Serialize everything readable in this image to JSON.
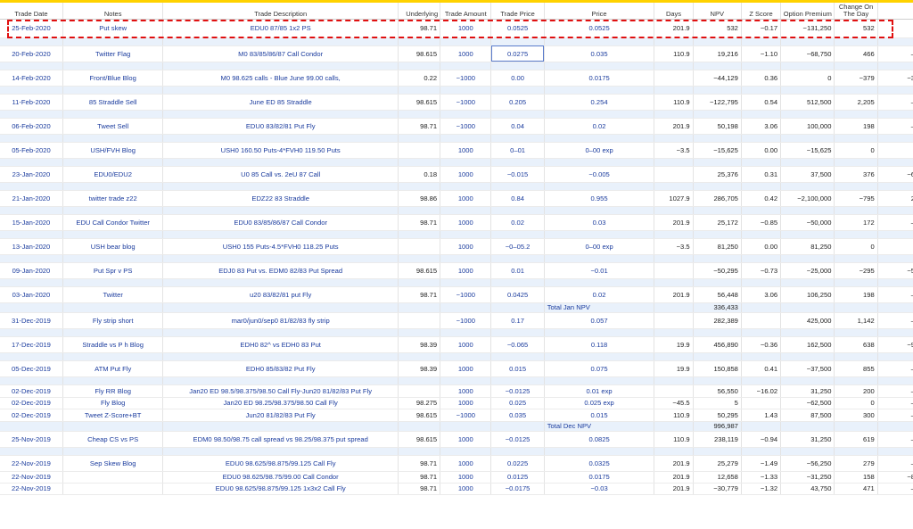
{
  "headers": [
    "Trade Date",
    "Notes",
    "Trade Description",
    "Underlying",
    "Trade Amount",
    "Trade Price",
    "Price",
    "Days",
    "NPV",
    "Z Score",
    "Option Premium",
    "Change On The Day",
    ""
  ],
  "rows": [
    {
      "kind": "main",
      "h": 21,
      "cells": [
        "25-Feb-2020",
        "Put skew",
        "EDU0 87/85 1x2 PS",
        "98.71",
        "1000",
        "0.0525",
        "0.0525",
        "201.9",
        "532",
        "−0.17",
        "−131,250",
        "532",
        ""
      ]
    },
    {
      "kind": "sub",
      "cells": []
    },
    {
      "kind": "main",
      "h": 18,
      "cells": [
        "20-Feb-2020",
        "Twitter Flag",
        "M0 83/85/86/87 Call Condor",
        "98.615",
        "1000",
        "0.0275",
        "0.035",
        "110.9",
        "19,216",
        "−1.10",
        "−68,750",
        "466",
        "–"
      ]
    },
    {
      "kind": "sub",
      "cells": []
    },
    {
      "kind": "main",
      "h": 18,
      "cells": [
        "14-Feb-2020",
        "Front/Blue Blog",
        "M0 98.625 calls - Blue June 99.00 calls,",
        "0.22",
        "−1000",
        "0.00",
        "0.0175",
        "",
        "−44,129",
        "0.36",
        "0",
        "−379",
        "−3"
      ]
    },
    {
      "kind": "sub",
      "cells": []
    },
    {
      "kind": "main",
      "h": 18,
      "cells": [
        "11-Feb-2020",
        "85 Straddle Sell",
        "June ED 85 Straddle",
        "98.615",
        "−1000",
        "0.205",
        "0.254",
        "110.9",
        "−122,795",
        "0.54",
        "512,500",
        "2,205",
        "–"
      ]
    },
    {
      "kind": "sub",
      "cells": []
    },
    {
      "kind": "main",
      "h": 18,
      "cells": [
        "06-Feb-2020",
        "Tweet Sell",
        "EDU0 83/82/81 Put Fly",
        "98.71",
        "−1000",
        "0.04",
        "0.02",
        "201.9",
        "50,198",
        "3.06",
        "100,000",
        "198",
        "–"
      ]
    },
    {
      "kind": "sub",
      "cells": []
    },
    {
      "kind": "main",
      "h": 18,
      "cells": [
        "05-Feb-2020",
        "USH/FVH Blog",
        "USH0 160.50 Puts-4*FVH0 119.50 Puts",
        "",
        "1000",
        "0–01",
        "0–00 exp",
        "−3.5",
        "−15,625",
        "0.00",
        "−15,625",
        "0",
        ""
      ]
    },
    {
      "kind": "sub",
      "cells": []
    },
    {
      "kind": "main",
      "h": 18,
      "cells": [
        "23-Jan-2020",
        "EDU0/EDU2",
        "U0 85 Call vs. 2eU 87 Call",
        "0.18",
        "1000",
        "−0.015",
        "−0.005",
        "",
        "25,376",
        "0.31",
        "37,500",
        "376",
        "−6"
      ]
    },
    {
      "kind": "sub",
      "cells": []
    },
    {
      "kind": "main",
      "h": 18,
      "cells": [
        "21-Jan-2020",
        "twitter trade z22",
        "EDZ22 83 Straddle",
        "98.86",
        "1000",
        "0.84",
        "0.955",
        "1027.9",
        "286,705",
        "0.42",
        "−2,100,000",
        "−795",
        "2"
      ]
    },
    {
      "kind": "sub",
      "cells": []
    },
    {
      "kind": "main",
      "h": 18,
      "cells": [
        "15-Jan-2020",
        "EDU Call Condor Twitter",
        "EDU0 83/85/86/87 Call Condor",
        "98.71",
        "1000",
        "0.02",
        "0.03",
        "201.9",
        "25,172",
        "−0.85",
        "−50,000",
        "172",
        "–"
      ]
    },
    {
      "kind": "sub",
      "cells": []
    },
    {
      "kind": "main",
      "h": 18,
      "cells": [
        "13-Jan-2020",
        "USH bear blog",
        "USH0 155 Puts-4.5*FVH0 118.25 Puts",
        "",
        "1000",
        "−0–05.2",
        "0–00 exp",
        "−3.5",
        "81,250",
        "0.00",
        "81,250",
        "0",
        ""
      ]
    },
    {
      "kind": "sub",
      "cells": []
    },
    {
      "kind": "main",
      "h": 18,
      "cells": [
        "09-Jan-2020",
        "Put Spr v PS",
        "EDJ0 83 Put vs. EDM0 82/83 Put Spread",
        "98.615",
        "1000",
        "0.01",
        "−0.01",
        "",
        "−50,295",
        "−0.73",
        "−25,000",
        "−295",
        "−5"
      ]
    },
    {
      "kind": "sub",
      "cells": []
    },
    {
      "kind": "main",
      "h": 18,
      "cells": [
        "03-Jan-2020",
        "Twitter",
        "u20 83/82/81 put Fly",
        "98.71",
        "−1000",
        "0.0425",
        "0.02",
        "201.9",
        "56,448",
        "3.06",
        "106,250",
        "198",
        "–"
      ]
    },
    {
      "kind": "total",
      "h": 11,
      "cells": [
        "",
        "",
        "",
        "",
        "",
        "",
        "Total Jan NPV",
        "",
        "336,433",
        "",
        "",
        "",
        ""
      ]
    },
    {
      "kind": "main",
      "h": 18,
      "cells": [
        "31-Dec-2019",
        "Fly strip short",
        "mar0/jun0/sep0 81/82/83 fly strip",
        "",
        "−1000",
        "0.17",
        "0.057",
        "",
        "282,389",
        "",
        "425,000",
        "1,142",
        "–"
      ]
    },
    {
      "kind": "sub",
      "cells": []
    },
    {
      "kind": "main",
      "h": 18,
      "cells": [
        "17-Dec-2019",
        "Straddle vs P h Blog",
        "EDH0 82^ vs EDH0 83 Put",
        "98.39",
        "1000",
        "−0.065",
        "0.118",
        "19.9",
        "456,890",
        "−0.36",
        "162,500",
        "638",
        "−9"
      ]
    },
    {
      "kind": "sub",
      "cells": []
    },
    {
      "kind": "main",
      "h": 18,
      "cells": [
        "05-Dec-2019",
        "ATM Put Fly",
        "EDH0 85/83/82 Put Fly",
        "98.39",
        "1000",
        "0.015",
        "0.075",
        "19.9",
        "150,858",
        "0.41",
        "−37,500",
        "855",
        "–"
      ]
    },
    {
      "kind": "sub",
      "cells": []
    },
    {
      "kind": "main",
      "h": 14,
      "cells": [
        "02-Dec-2019",
        "Fly RR Blog",
        "Jan20 ED 98.5/98.375/98.50 Call Fly-Jun20 81/82/83 Put Fly",
        "",
        "1000",
        "−0.0125",
        "0.01 exp",
        "",
        "56,550",
        "−16.02",
        "31,250",
        "200",
        "–"
      ]
    },
    {
      "kind": "main",
      "h": 13,
      "cells": [
        "02-Dec-2019",
        "Fly Blog",
        "Jan20 ED 98.25/98.375/98.50 Call Fly",
        "98.275",
        "1000",
        "0.025",
        "0.025 exp",
        "−45.5",
        "5",
        "",
        "−62,500",
        "0",
        "–"
      ]
    },
    {
      "kind": "main",
      "h": 14,
      "cells": [
        "02-Dec-2019",
        "Tweet Z-Score+BT",
        "Jun20 81/82/83 Put Fly",
        "98.615",
        "−1000",
        "0.035",
        "0.015",
        "110.9",
        "50,295",
        "1.43",
        "87,500",
        "300",
        "–"
      ]
    },
    {
      "kind": "total",
      "h": 11,
      "cells": [
        "",
        "",
        "",
        "",
        "",
        "",
        "Total Dec NPV",
        "",
        "996,987",
        "",
        "",
        "",
        ""
      ]
    },
    {
      "kind": "main",
      "h": 18,
      "cells": [
        "25-Nov-2019",
        "Cheap CS vs PS",
        "EDM0 98.50/98.75 call spread vs 98.25/98.375 put spread",
        "98.615",
        "1000",
        "−0.0125",
        "0.0825",
        "110.9",
        "238,119",
        "−0.94",
        "31,250",
        "619",
        "–"
      ]
    },
    {
      "kind": "sub",
      "cells": []
    },
    {
      "kind": "main",
      "h": 18,
      "cells": [
        "22-Nov-2019",
        "Sep Skew Blog",
        "EDU0 98.625/98.875/99.125 Call Fly",
        "98.71",
        "1000",
        "0.0225",
        "0.0325",
        "201.9",
        "25,279",
        "−1.49",
        "−56,250",
        "279",
        "–"
      ]
    },
    {
      "kind": "main",
      "h": 13,
      "cells": [
        "22-Nov-2019",
        "",
        "EDU0 98.625/98.75/99.00 Call Condor",
        "98.71",
        "1000",
        "0.0125",
        "0.0175",
        "201.9",
        "12,658",
        "−1.33",
        "−31,250",
        "158",
        "−8"
      ]
    },
    {
      "kind": "main",
      "h": 13,
      "cells": [
        "22-Nov-2019",
        "",
        "EDU0 98.625/98.875/99.125 1x3x2 Call Fly",
        "98.71",
        "1000",
        "−0.0175",
        "−0.03",
        "201.9",
        "−30,779",
        "−1.32",
        "43,750",
        "471",
        "–"
      ]
    }
  ]
}
